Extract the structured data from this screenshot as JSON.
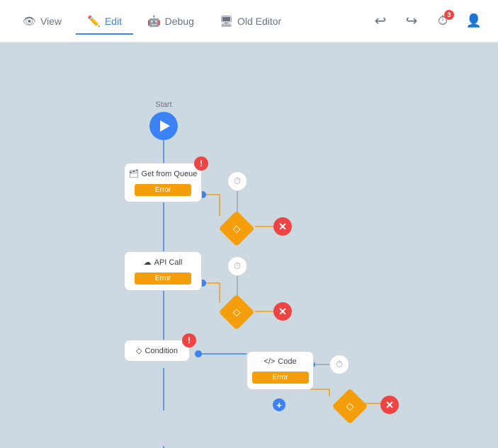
{
  "toolbar": {
    "nav_items": [
      {
        "id": "view",
        "label": "View",
        "icon": "👁",
        "active": false
      },
      {
        "id": "edit",
        "label": "Edit",
        "icon": "✏️",
        "active": true
      },
      {
        "id": "debug",
        "label": "Debug",
        "icon": "🐛",
        "active": false
      },
      {
        "id": "old-editor",
        "label": "Old Editor",
        "icon": "🖥",
        "active": false
      }
    ],
    "undo_label": "↩",
    "redo_label": "↪",
    "timer_badge": "3",
    "add_user_label": "👤+"
  },
  "canvas": {
    "start_label": "Start",
    "nodes": [
      {
        "id": "get-from-queue",
        "label": "Get from Queue",
        "error_bar": "Error"
      },
      {
        "id": "api-call",
        "label": "API Call",
        "error_bar": "Error"
      },
      {
        "id": "condition",
        "label": "Condition"
      },
      {
        "id": "code",
        "label": "Code",
        "error_bar": "Error"
      }
    ]
  }
}
